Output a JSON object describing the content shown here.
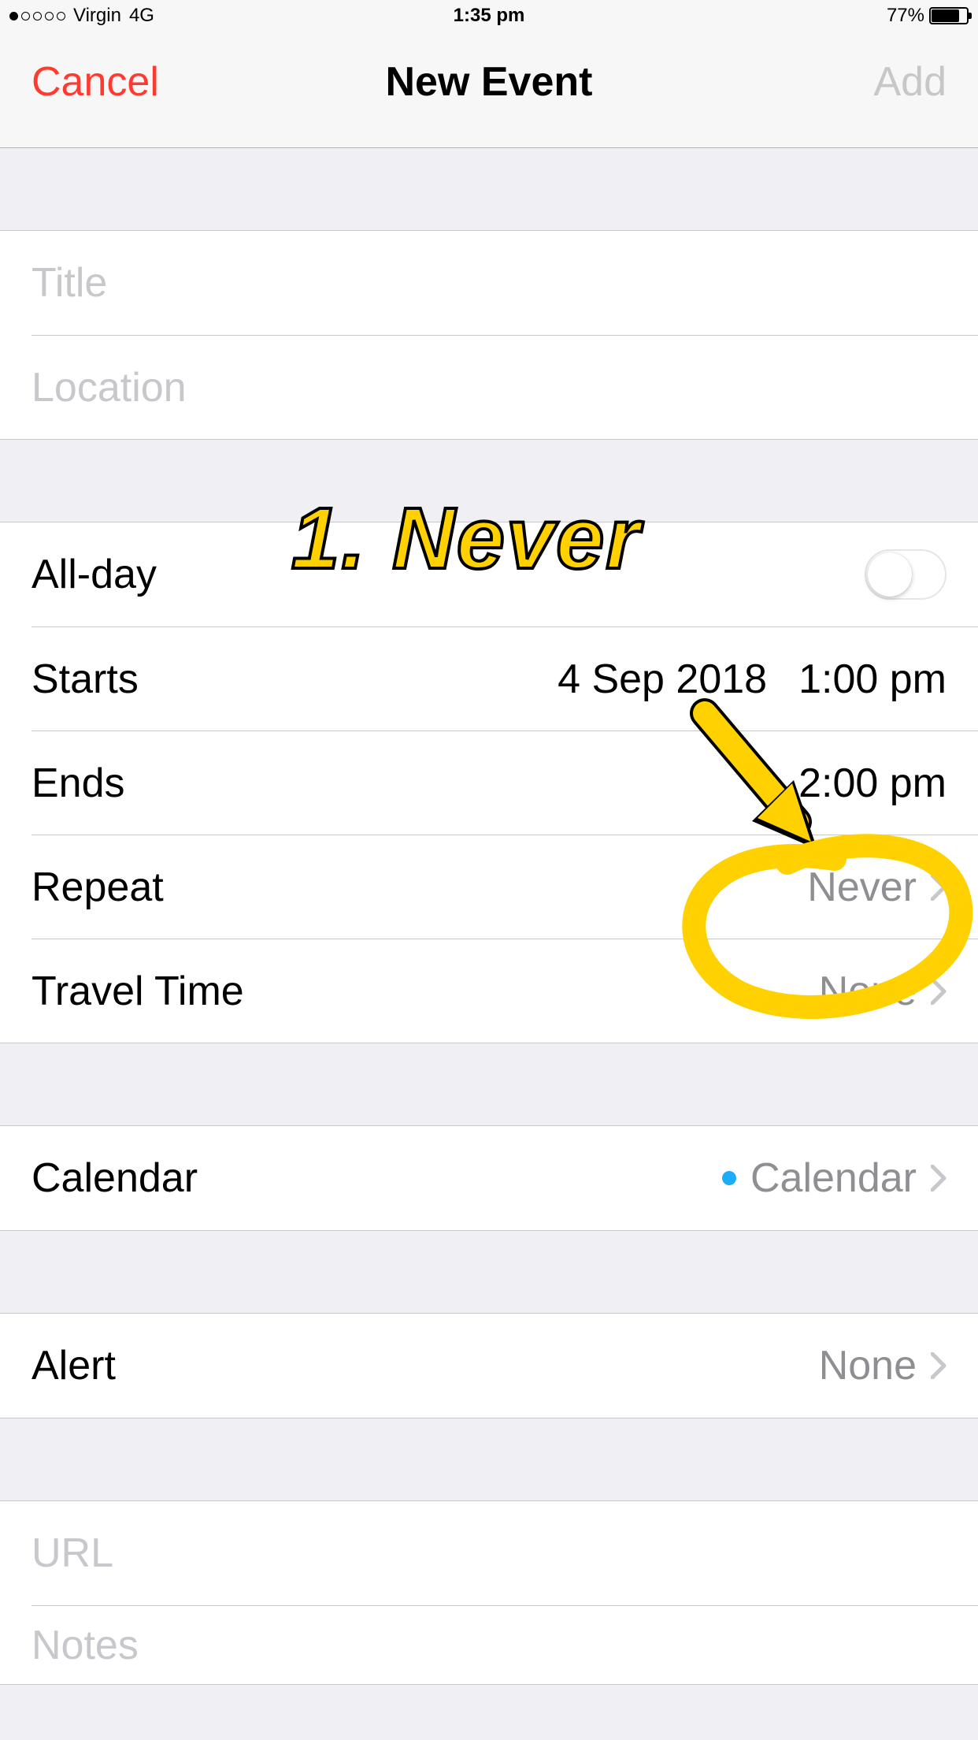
{
  "status": {
    "carrier": "Virgin",
    "network": "4G",
    "time": "1:35 pm",
    "battery_pct": "77%"
  },
  "nav": {
    "cancel": "Cancel",
    "title": "New Event",
    "add": "Add"
  },
  "fields": {
    "title_placeholder": "Title",
    "location_placeholder": "Location",
    "url_placeholder": "URL",
    "notes_placeholder": "Notes"
  },
  "schedule": {
    "allday_label": "All-day",
    "allday_on": false,
    "starts_label": "Starts",
    "starts_date": "4 Sep 2018",
    "starts_time": "1:00 pm",
    "ends_label": "Ends",
    "ends_time": "2:00 pm",
    "repeat_label": "Repeat",
    "repeat_value": "Never",
    "travel_label": "Travel Time",
    "travel_value": "None"
  },
  "calendar": {
    "label": "Calendar",
    "value": "Calendar"
  },
  "alert": {
    "label": "Alert",
    "value": "None"
  },
  "annotation": {
    "text": "1. Never"
  }
}
